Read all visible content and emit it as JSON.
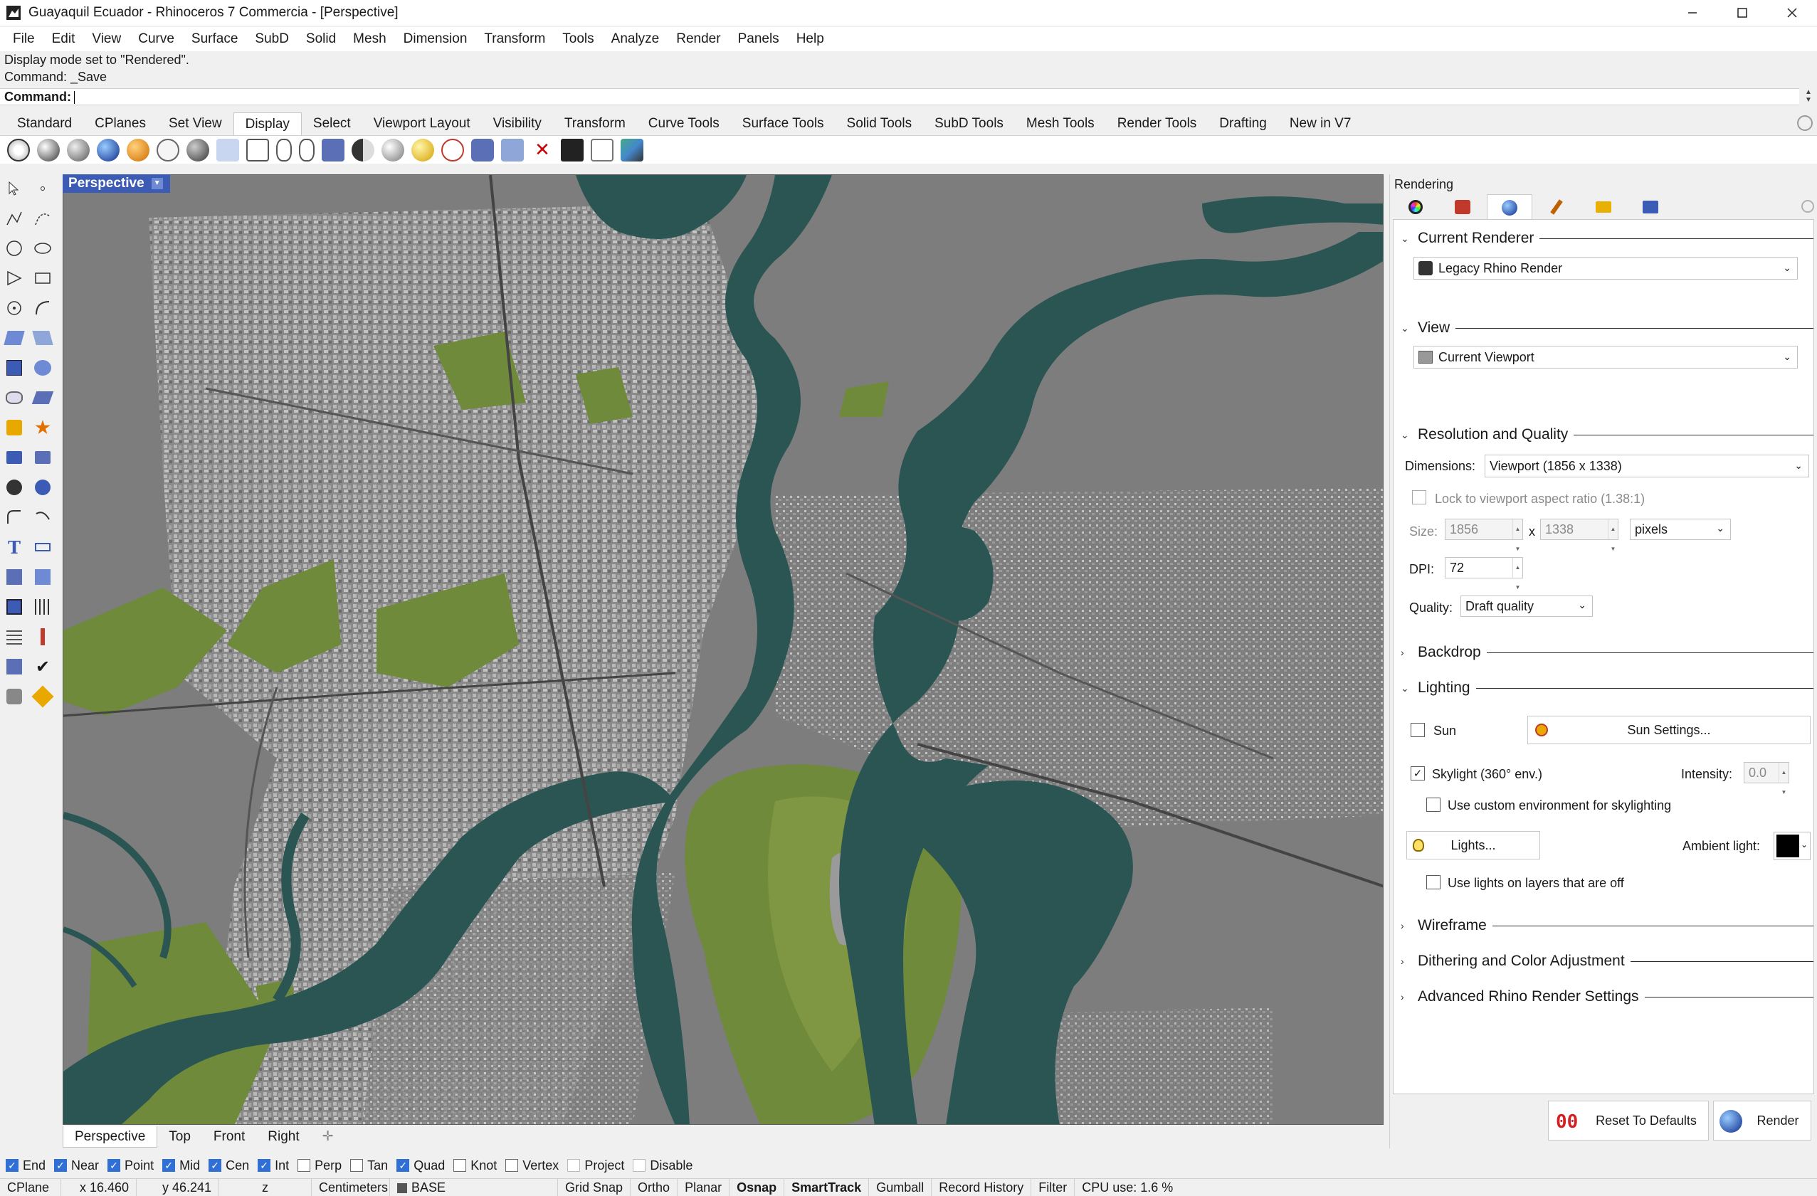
{
  "window": {
    "title": "Guayaquil Ecuador - Rhinoceros 7 Commercia - [Perspective]",
    "controls": [
      "minimize-icon",
      "maximize-icon",
      "close-icon"
    ]
  },
  "menu": [
    "File",
    "Edit",
    "View",
    "Curve",
    "Surface",
    "SubD",
    "Solid",
    "Mesh",
    "Dimension",
    "Transform",
    "Tools",
    "Analyze",
    "Render",
    "Panels",
    "Help"
  ],
  "command": {
    "history": [
      "Display mode set to \"Rendered\".",
      "Command: _Save"
    ],
    "prompt": "Command:"
  },
  "toolbar_tabs": [
    "Standard",
    "CPlanes",
    "Set View",
    "Display",
    "Select",
    "Viewport Layout",
    "Visibility",
    "Transform",
    "Curve Tools",
    "Surface Tools",
    "Solid Tools",
    "SubD Tools",
    "Mesh Tools",
    "Render Tools",
    "Drafting",
    "New in V7"
  ],
  "active_toolbar_tab": "Display",
  "viewport": {
    "label": "Perspective",
    "tabs": [
      "Perspective",
      "Top",
      "Front",
      "Right"
    ],
    "active_tab": "Perspective",
    "colors": {
      "water": "#2a5552",
      "land": "#7b7b7b",
      "vegetation": "#6e8a3a",
      "accent": "#3b5bb5"
    }
  },
  "panel": {
    "title": "Rendering",
    "sections": {
      "current_renderer": {
        "title": "Current Renderer",
        "value": "Legacy Rhino Render"
      },
      "view": {
        "title": "View",
        "value": "Current Viewport"
      },
      "resolution": {
        "title": "Resolution and Quality",
        "dimensions_label": "Dimensions:",
        "dimensions_value": "Viewport (1856 x 1338)",
        "lock_label": "Lock to viewport aspect ratio (1.38:1)",
        "size_label": "Size:",
        "width": "1856",
        "x": "x",
        "height": "1338",
        "unit": "pixels",
        "dpi_label": "DPI:",
        "dpi": "72",
        "quality_label": "Quality:",
        "quality": "Draft quality"
      },
      "backdrop": {
        "title": "Backdrop"
      },
      "lighting": {
        "title": "Lighting",
        "sun_label": "Sun",
        "sun_settings": "Sun Settings...",
        "skylight_label": "Skylight (360° env.)",
        "intensity_label": "Intensity:",
        "intensity": "0.0",
        "custom_env_label": "Use custom environment for skylighting",
        "lights_button": "Lights...",
        "ambient_label": "Ambient light:",
        "lights_off_label": "Use lights on layers that are off"
      },
      "wireframe": {
        "title": "Wireframe"
      },
      "dithering": {
        "title": "Dithering and Color Adjustment"
      },
      "advanced": {
        "title": "Advanced Rhino Render Settings"
      }
    },
    "footer": {
      "reset": "Reset To Defaults",
      "render": "Render"
    }
  },
  "osnaps": [
    {
      "label": "End",
      "on": true
    },
    {
      "label": "Near",
      "on": true
    },
    {
      "label": "Point",
      "on": true
    },
    {
      "label": "Mid",
      "on": true
    },
    {
      "label": "Cen",
      "on": true
    },
    {
      "label": "Int",
      "on": true
    },
    {
      "label": "Perp",
      "on": false
    },
    {
      "label": "Tan",
      "on": false
    },
    {
      "label": "Quad",
      "on": true
    },
    {
      "label": "Knot",
      "on": false
    },
    {
      "label": "Vertex",
      "on": false
    },
    {
      "label": "Project",
      "on": false
    },
    {
      "label": "Disable",
      "on": false
    }
  ],
  "status": {
    "cplane": "CPlane",
    "x": "x 16.460",
    "y": "y 46.241",
    "z": "z",
    "units": "Centimeters",
    "layer": "BASE",
    "grid_snap": "Grid Snap",
    "ortho": "Ortho",
    "planar": "Planar",
    "osnap": "Osnap",
    "smarttrack": "SmartTrack",
    "gumball": "Gumball",
    "record_history": "Record History",
    "filter": "Filter",
    "cpu": "CPU use: 1.6 %"
  }
}
